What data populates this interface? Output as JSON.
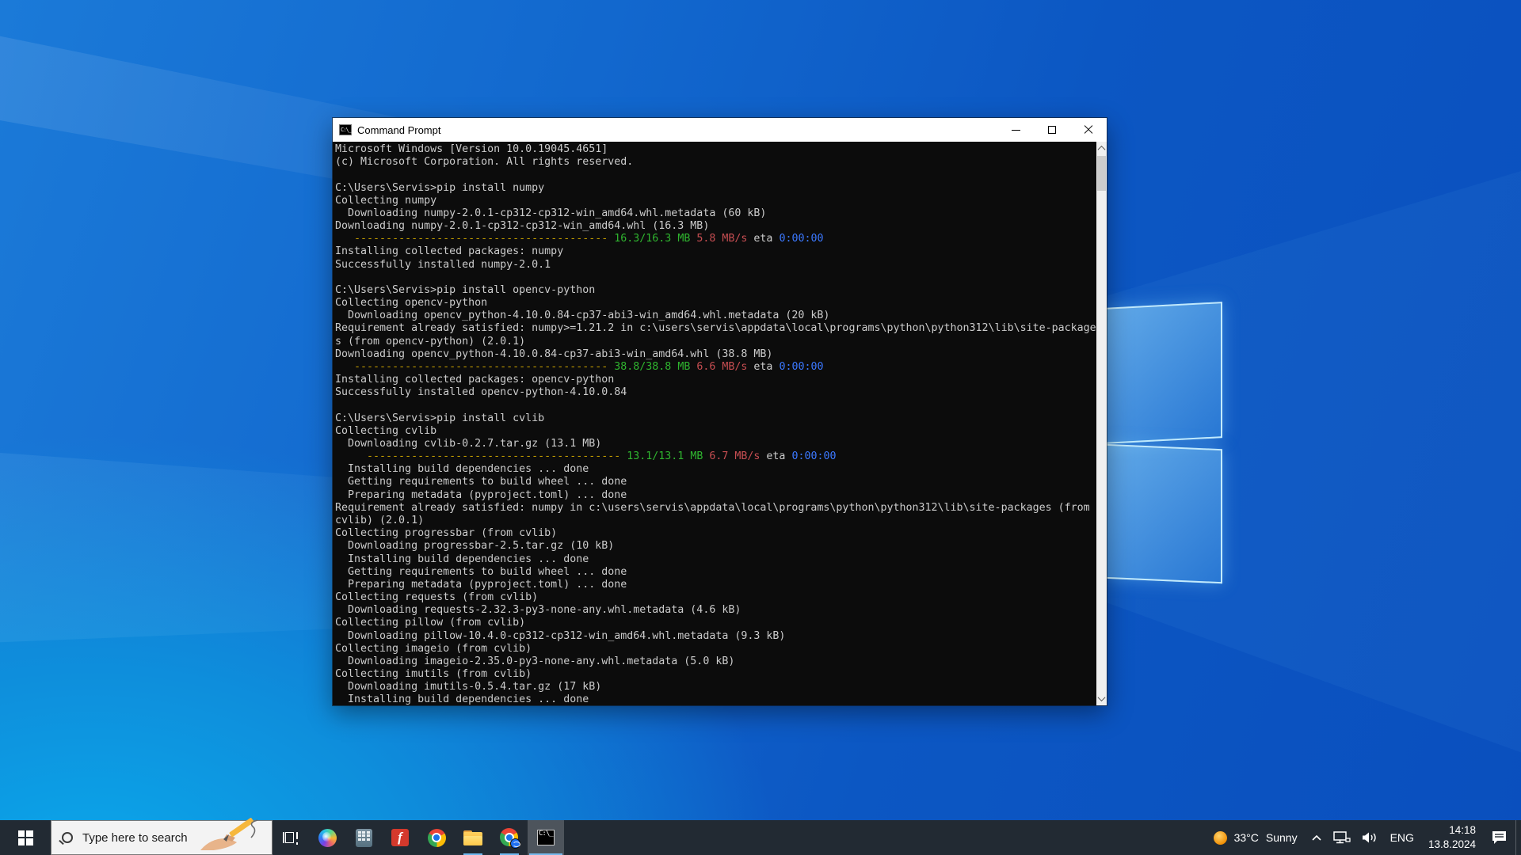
{
  "window": {
    "title": "Command Prompt",
    "controls": {
      "minimize": "minimize",
      "maximize": "maximize",
      "close": "close"
    }
  },
  "console": {
    "bg": "#0C0C0C",
    "palette": {
      "default": "#CCCCCC",
      "yellow": "#C19C00",
      "green": "#2FB52F",
      "red": "#C74E52",
      "blue": "#3B78FF"
    },
    "lines": [
      [
        {
          "t": "Microsoft Windows [Version 10.0.19045.4651]",
          "c": "d"
        }
      ],
      [
        {
          "t": "(c) Microsoft Corporation. All rights reserved.",
          "c": "d"
        }
      ],
      [
        {
          "t": "",
          "c": "d"
        }
      ],
      [
        {
          "t": "C:\\Users\\Servis>pip install numpy",
          "c": "d"
        }
      ],
      [
        {
          "t": "Collecting numpy",
          "c": "d"
        }
      ],
      [
        {
          "t": "  Downloading numpy-2.0.1-cp312-cp312-win_amd64.whl.metadata (60 kB)",
          "c": "d"
        }
      ],
      [
        {
          "t": "Downloading numpy-2.0.1-cp312-cp312-win_amd64.whl (16.3 MB)",
          "c": "d"
        }
      ],
      [
        {
          "t": "   ",
          "c": "d"
        },
        {
          "t": "----------------------------------------",
          "c": "y"
        },
        {
          "t": " ",
          "c": "d"
        },
        {
          "t": "16.3/16.3 MB",
          "c": "g"
        },
        {
          "t": " ",
          "c": "d"
        },
        {
          "t": "5.8 MB/s",
          "c": "r"
        },
        {
          "t": " eta ",
          "c": "d"
        },
        {
          "t": "0:00:00",
          "c": "b"
        }
      ],
      [
        {
          "t": "Installing collected packages: numpy",
          "c": "d"
        }
      ],
      [
        {
          "t": "Successfully installed numpy-2.0.1",
          "c": "d"
        }
      ],
      [
        {
          "t": "",
          "c": "d"
        }
      ],
      [
        {
          "t": "C:\\Users\\Servis>pip install opencv-python",
          "c": "d"
        }
      ],
      [
        {
          "t": "Collecting opencv-python",
          "c": "d"
        }
      ],
      [
        {
          "t": "  Downloading opencv_python-4.10.0.84-cp37-abi3-win_amd64.whl.metadata (20 kB)",
          "c": "d"
        }
      ],
      [
        {
          "t": "Requirement already satisfied: numpy>=1.21.2 in c:\\users\\servis\\appdata\\local\\programs\\python\\python312\\lib\\site-package",
          "c": "d"
        }
      ],
      [
        {
          "t": "s (from opencv-python) (2.0.1)",
          "c": "d"
        }
      ],
      [
        {
          "t": "Downloading opencv_python-4.10.0.84-cp37-abi3-win_amd64.whl (38.8 MB)",
          "c": "d"
        }
      ],
      [
        {
          "t": "   ",
          "c": "d"
        },
        {
          "t": "----------------------------------------",
          "c": "y"
        },
        {
          "t": " ",
          "c": "d"
        },
        {
          "t": "38.8/38.8 MB",
          "c": "g"
        },
        {
          "t": " ",
          "c": "d"
        },
        {
          "t": "6.6 MB/s",
          "c": "r"
        },
        {
          "t": " eta ",
          "c": "d"
        },
        {
          "t": "0:00:00",
          "c": "b"
        }
      ],
      [
        {
          "t": "Installing collected packages: opencv-python",
          "c": "d"
        }
      ],
      [
        {
          "t": "Successfully installed opencv-python-4.10.0.84",
          "c": "d"
        }
      ],
      [
        {
          "t": "",
          "c": "d"
        }
      ],
      [
        {
          "t": "C:\\Users\\Servis>pip install cvlib",
          "c": "d"
        }
      ],
      [
        {
          "t": "Collecting cvlib",
          "c": "d"
        }
      ],
      [
        {
          "t": "  Downloading cvlib-0.2.7.tar.gz (13.1 MB)",
          "c": "d"
        }
      ],
      [
        {
          "t": "     ",
          "c": "d"
        },
        {
          "t": "----------------------------------------",
          "c": "y"
        },
        {
          "t": " ",
          "c": "d"
        },
        {
          "t": "13.1/13.1 MB",
          "c": "g"
        },
        {
          "t": " ",
          "c": "d"
        },
        {
          "t": "6.7 MB/s",
          "c": "r"
        },
        {
          "t": " eta ",
          "c": "d"
        },
        {
          "t": "0:00:00",
          "c": "b"
        }
      ],
      [
        {
          "t": "  Installing build dependencies ... done",
          "c": "d"
        }
      ],
      [
        {
          "t": "  Getting requirements to build wheel ... done",
          "c": "d"
        }
      ],
      [
        {
          "t": "  Preparing metadata (pyproject.toml) ... done",
          "c": "d"
        }
      ],
      [
        {
          "t": "Requirement already satisfied: numpy in c:\\users\\servis\\appdata\\local\\programs\\python\\python312\\lib\\site-packages (from",
          "c": "d"
        }
      ],
      [
        {
          "t": "cvlib) (2.0.1)",
          "c": "d"
        }
      ],
      [
        {
          "t": "Collecting progressbar (from cvlib)",
          "c": "d"
        }
      ],
      [
        {
          "t": "  Downloading progressbar-2.5.tar.gz (10 kB)",
          "c": "d"
        }
      ],
      [
        {
          "t": "  Installing build dependencies ... done",
          "c": "d"
        }
      ],
      [
        {
          "t": "  Getting requirements to build wheel ... done",
          "c": "d"
        }
      ],
      [
        {
          "t": "  Preparing metadata (pyproject.toml) ... done",
          "c": "d"
        }
      ],
      [
        {
          "t": "Collecting requests (from cvlib)",
          "c": "d"
        }
      ],
      [
        {
          "t": "  Downloading requests-2.32.3-py3-none-any.whl.metadata (4.6 kB)",
          "c": "d"
        }
      ],
      [
        {
          "t": "Collecting pillow (from cvlib)",
          "c": "d"
        }
      ],
      [
        {
          "t": "  Downloading pillow-10.4.0-cp312-cp312-win_amd64.whl.metadata (9.3 kB)",
          "c": "d"
        }
      ],
      [
        {
          "t": "Collecting imageio (from cvlib)",
          "c": "d"
        }
      ],
      [
        {
          "t": "  Downloading imageio-2.35.0-py3-none-any.whl.metadata (5.0 kB)",
          "c": "d"
        }
      ],
      [
        {
          "t": "Collecting imutils (from cvlib)",
          "c": "d"
        }
      ],
      [
        {
          "t": "  Downloading imutils-0.5.4.tar.gz (17 kB)",
          "c": "d"
        }
      ],
      [
        {
          "t": "  Installing build dependencies ... done",
          "c": "d"
        }
      ]
    ]
  },
  "taskbar": {
    "bg": "#222A33",
    "search": {
      "placeholder": "Type here to search"
    },
    "app_icons": [
      {
        "name": "task-view-icon"
      },
      {
        "name": "copilot-icon"
      },
      {
        "name": "calculator-icon"
      },
      {
        "name": "red-f-app-icon",
        "glyph": "f"
      },
      {
        "name": "chrome-icon"
      },
      {
        "name": "file-explorer-icon",
        "running": true
      },
      {
        "name": "chrome-shortcut-icon",
        "running": true
      },
      {
        "name": "command-prompt-icon",
        "running": true,
        "active": true
      }
    ],
    "tray": {
      "weather": {
        "temp": "33°C",
        "condition": "Sunny"
      },
      "language": "ENG",
      "time": "14:18",
      "date": "13.8.2024"
    }
  }
}
